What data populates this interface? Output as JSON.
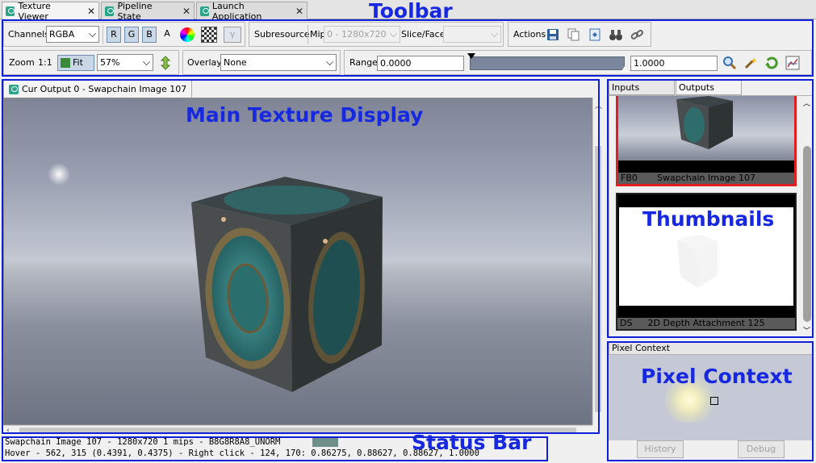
{
  "doc_tabs": [
    {
      "label": "Texture Viewer"
    },
    {
      "label": "Pipeline State"
    },
    {
      "label": "Launch Application"
    }
  ],
  "toolbar": {
    "channels_label": "Channels",
    "channels_value": "RGBA",
    "r": "R",
    "g": "G",
    "b": "B",
    "a": "A",
    "gamma": "γ",
    "subresource_label": "Subresource",
    "mip_label": "Mip",
    "mip_value": "0 - 1280x720",
    "slice_label": "Slice/Face",
    "slice_value": "",
    "actions_label": "Actions",
    "zoom_label": "Zoom",
    "zoom_one": "1:1",
    "fit_label": "Fit",
    "zoom_value": "57%",
    "overlay_label": "Overlay",
    "overlay_value": "None",
    "range_label": "Range",
    "range_min": "0.0000",
    "range_max": "1.0000"
  },
  "main": {
    "tab_label": "Cur Output 0 - Swapchain Image 107"
  },
  "status": {
    "line1": "Swapchain Image 107 - 1280x720 1 mips - B8G8R8A8_UNORM",
    "line2": "Hover -  562,  315 (0.4391, 0.4375) - Right click -  124,  170: 0.86275, 0.88627, 0.88627, 1.0000",
    "swatch_color": "#6f9089"
  },
  "side": {
    "tabs": [
      {
        "label": "Inputs"
      },
      {
        "label": "Outputs"
      }
    ],
    "thumbs": [
      {
        "slot": "FB0",
        "name": "Swapchain Image 107"
      },
      {
        "slot": "DS",
        "name": "2D Depth Attachment 125"
      }
    ]
  },
  "pixel": {
    "title": "Pixel Context",
    "history": "History",
    "debug": "Debug"
  },
  "annotations": {
    "toolbar": "Toolbar",
    "main": "Main Texture Display",
    "thumbs": "Thumbnails",
    "pixel": "Pixel Context",
    "status": "Status Bar"
  },
  "colors": {
    "annotation": "#1628e0",
    "selected_thumb_border": "#e02020",
    "tab_icon": "#2aa58a"
  }
}
